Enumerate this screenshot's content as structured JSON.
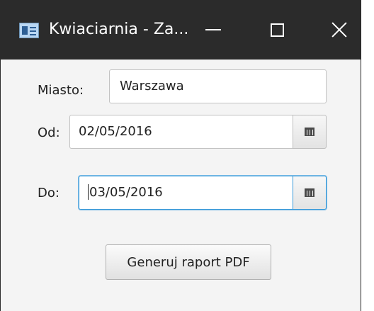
{
  "window": {
    "title": "Kwiaciarnia - Za...",
    "controls": {
      "minimize": "minimize-icon",
      "maximize": "maximize-icon",
      "close": "close-icon"
    },
    "titlebar_color": "#2b2b2b"
  },
  "form": {
    "city": {
      "label": "Miasto:",
      "value": "Warszawa"
    },
    "from": {
      "label": "Od:",
      "value": "02/05/2016",
      "icon": "calendar-icon"
    },
    "to": {
      "label": "Do:",
      "value": "03/05/2016",
      "icon": "calendar-icon",
      "focused": true
    },
    "generate_label": "Generuj raport PDF"
  },
  "colors": {
    "focus": "#3a9ad9",
    "background": "#f4f4f4"
  }
}
